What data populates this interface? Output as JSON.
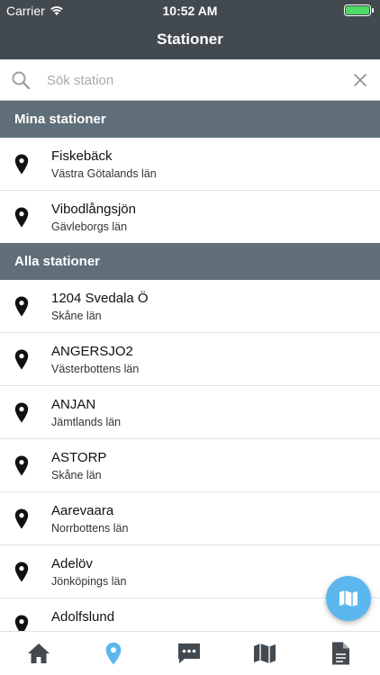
{
  "status_bar": {
    "carrier": "Carrier",
    "time": "10:52 AM"
  },
  "nav": {
    "title": "Stationer"
  },
  "search": {
    "placeholder": "Sök station",
    "value": ""
  },
  "sections": {
    "mine": {
      "header": "Mina stationer",
      "items": [
        {
          "name": "Fiskebäck",
          "region": "Västra Götalands län"
        },
        {
          "name": "Vibodlångsjön",
          "region": "Gävleborgs län"
        }
      ]
    },
    "all": {
      "header": "Alla stationer",
      "items": [
        {
          "name": "1204 Svedala Ö",
          "region": "Skåne län"
        },
        {
          "name": "ANGERSJO2",
          "region": "Västerbottens län"
        },
        {
          "name": "ANJAN",
          "region": "Jämtlands län"
        },
        {
          "name": "ASTORP",
          "region": "Skåne län"
        },
        {
          "name": "Aarevaara",
          "region": "Norrbottens län"
        },
        {
          "name": "Adelöv",
          "region": "Jönköpings län"
        },
        {
          "name": "Adolfslund",
          "region": ""
        }
      ]
    }
  },
  "tabs": [
    {
      "icon": "home-icon",
      "active": false
    },
    {
      "icon": "location-pin-icon",
      "active": true
    },
    {
      "icon": "chat-icon",
      "active": false
    },
    {
      "icon": "map-icon",
      "active": false
    },
    {
      "icon": "document-icon",
      "active": false
    }
  ],
  "colors": {
    "nav_bg": "#424a50",
    "section_bg": "#5f6e78",
    "accent": "#5cb7ee",
    "tab_inactive": "#424a50"
  }
}
